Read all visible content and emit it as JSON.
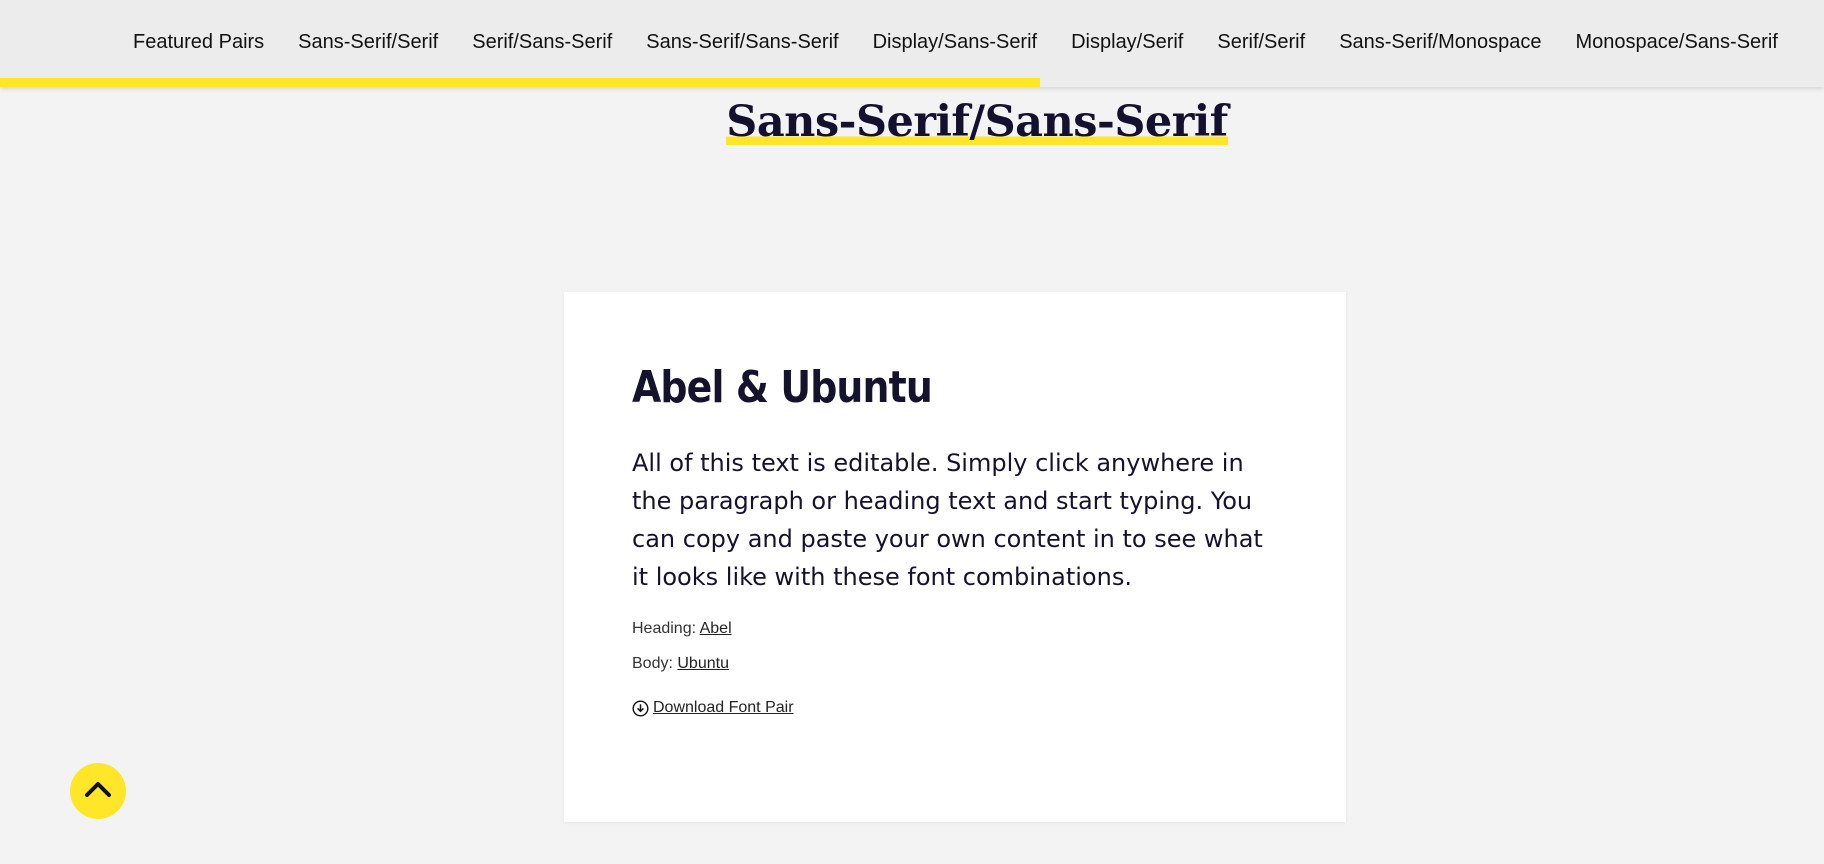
{
  "nav": {
    "items": [
      {
        "label": "Featured Pairs"
      },
      {
        "label": "Sans-Serif/Serif"
      },
      {
        "label": "Serif/Sans-Serif"
      },
      {
        "label": "Sans-Serif/Sans-Serif"
      },
      {
        "label": "Display/Sans-Serif"
      },
      {
        "label": "Display/Serif"
      },
      {
        "label": "Serif/Serif"
      },
      {
        "label": "Sans-Serif/Monospace"
      },
      {
        "label": "Monospace/Sans-Serif"
      }
    ],
    "scroll_progress": 0.57
  },
  "section": {
    "title": "Sans-Serif/Sans-Serif"
  },
  "card": {
    "heading": "Abel & Ubuntu",
    "body": "All of this text is editable. Simply click anywhere in the paragraph or heading text and start typing. You can copy and paste your own content in to see what it looks like with these font combinations.",
    "heading_label": "Heading:",
    "heading_font": "Abel",
    "body_label": "Body:",
    "body_font": "Ubuntu",
    "download_label": "Download Font Pair"
  },
  "icons": {
    "download": "download-circle-icon",
    "back_to_top": "chevron-up-icon"
  },
  "colors": {
    "accent": "#ffe629",
    "heading_text": "#14112e",
    "page_bg": "#f3f3f3",
    "card_bg": "#ffffff"
  }
}
